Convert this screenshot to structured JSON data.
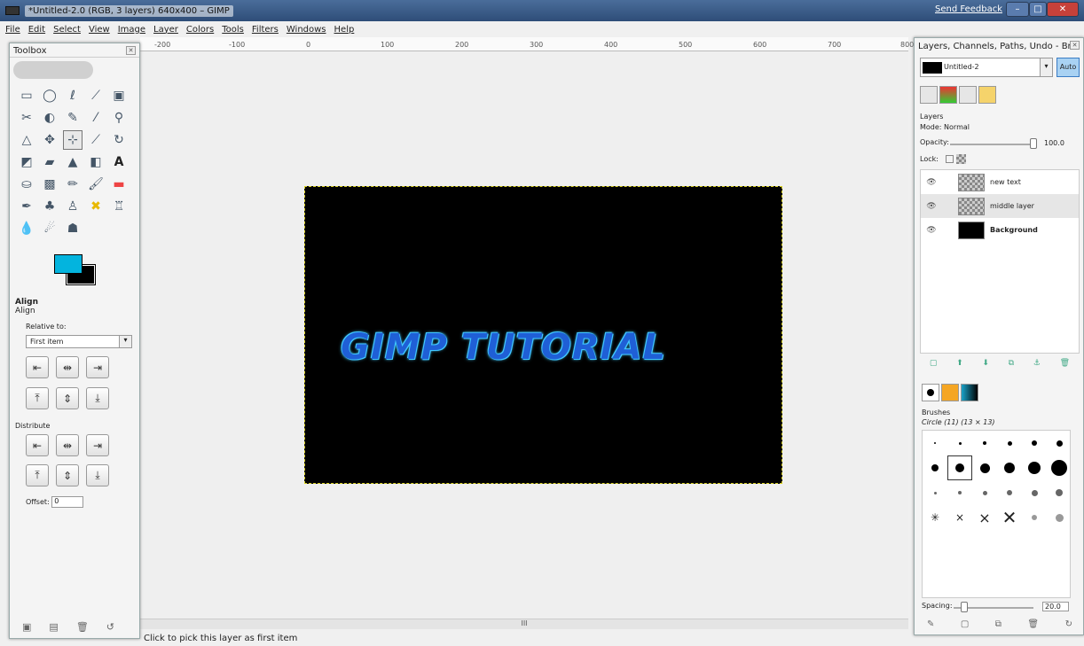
{
  "window": {
    "title": "*Untitled-2.0 (RGB, 3 layers) 640x400 – GIMP",
    "feedback": "Send Feedback"
  },
  "menu": [
    "File",
    "Edit",
    "Select",
    "View",
    "Image",
    "Layer",
    "Colors",
    "Tools",
    "Filters",
    "Windows",
    "Help"
  ],
  "ruler": [
    "-200",
    "-100",
    "0",
    "100",
    "200",
    "300",
    "400",
    "500",
    "600",
    "700",
    "800"
  ],
  "canvas": {
    "text": "GIMP TUTORIAL",
    "image_bg": "#000000",
    "text_color": "#1f5fd6",
    "glow_color": "#42c8ff"
  },
  "hscroll": {
    "mark": "III"
  },
  "status": {
    "message": "Click to pick this layer as first item"
  },
  "toolbox": {
    "title": "Toolbox",
    "fg_color": "#03b4de",
    "bg_color": "#000000",
    "align": {
      "title": "Align",
      "subtitle": "Align",
      "relative_label": "Relative to:",
      "relative_value": "First item",
      "distribute_label": "Distribute",
      "offset_label": "Offset:",
      "offset_value": "0"
    }
  },
  "dock": {
    "title": "Layers, Channels, Paths, Undo - Br...",
    "image_name": "Untitled-2",
    "auto_label": "Auto",
    "layers_label": "Layers",
    "mode_label": "Mode:",
    "mode_value": "Normal",
    "opacity_label": "Opacity:",
    "opacity_value": "100.0",
    "lock_label": "Lock:",
    "layers": [
      {
        "name": "new text"
      },
      {
        "name": "middle layer"
      },
      {
        "name": "Background"
      }
    ],
    "brushes_label": "Brushes",
    "brush_name": "Circle (11) (13 × 13)",
    "spacing_label": "Spacing:",
    "spacing_value": "20.0"
  }
}
